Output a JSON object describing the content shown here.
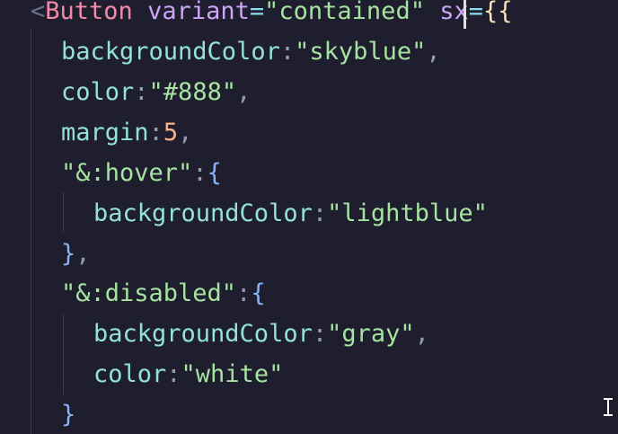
{
  "editor": {
    "theme_colors": {
      "background": "#1e1e2e",
      "tag": "#f38ba8",
      "attribute": "#cba6f7",
      "string": "#a6e3a1",
      "property": "#94e2d5",
      "number": "#fab387",
      "brace": "#f9e2af"
    },
    "lines": [
      {
        "tokens": [
          {
            "text": "<",
            "kind": "tag-punct"
          },
          {
            "text": "Button",
            "kind": "tag"
          },
          {
            "text": " ",
            "kind": "punct"
          },
          {
            "text": "variant",
            "kind": "attr"
          },
          {
            "text": "=",
            "kind": "op"
          },
          {
            "text": "\"contained\"",
            "kind": "str"
          },
          {
            "text": " ",
            "kind": "punct"
          },
          {
            "text": "sx",
            "kind": "attr"
          },
          {
            "text": "=",
            "kind": "op"
          },
          {
            "text": "{{",
            "kind": "brace"
          }
        ]
      },
      {
        "tokens": [
          {
            "text": "backgroundColor",
            "kind": "prop"
          },
          {
            "text": ":",
            "kind": "punct"
          },
          {
            "text": "\"skyblue\"",
            "kind": "str"
          },
          {
            "text": ",",
            "kind": "punct"
          }
        ]
      },
      {
        "tokens": [
          {
            "text": "color",
            "kind": "prop"
          },
          {
            "text": ":",
            "kind": "punct"
          },
          {
            "text": "\"#888\"",
            "kind": "str"
          },
          {
            "text": ",",
            "kind": "punct"
          }
        ]
      },
      {
        "tokens": [
          {
            "text": "margin",
            "kind": "prop"
          },
          {
            "text": ":",
            "kind": "punct"
          },
          {
            "text": "5",
            "kind": "num"
          },
          {
            "text": ",",
            "kind": "punct"
          }
        ]
      },
      {
        "tokens": [
          {
            "text": "\"&:hover\"",
            "kind": "str"
          },
          {
            "text": ":",
            "kind": "punct"
          },
          {
            "text": "{",
            "kind": "paren"
          }
        ]
      },
      {
        "tokens": [
          {
            "text": "backgroundColor",
            "kind": "prop"
          },
          {
            "text": ":",
            "kind": "punct"
          },
          {
            "text": "\"lightblue\"",
            "kind": "str"
          }
        ]
      },
      {
        "tokens": [
          {
            "text": "}",
            "kind": "paren"
          },
          {
            "text": ",",
            "kind": "punct"
          }
        ]
      },
      {
        "tokens": [
          {
            "text": "\"&:disabled\"",
            "kind": "str"
          },
          {
            "text": ":",
            "kind": "punct"
          },
          {
            "text": "{",
            "kind": "paren"
          }
        ]
      },
      {
        "tokens": [
          {
            "text": "backgroundColor",
            "kind": "prop"
          },
          {
            "text": ":",
            "kind": "punct"
          },
          {
            "text": "\"gray\"",
            "kind": "str"
          },
          {
            "text": ",",
            "kind": "punct"
          }
        ]
      },
      {
        "tokens": [
          {
            "text": "color",
            "kind": "prop"
          },
          {
            "text": ":",
            "kind": "punct"
          },
          {
            "text": "\"white\"",
            "kind": "str"
          }
        ]
      },
      {
        "tokens": [
          {
            "text": "}",
            "kind": "paren"
          }
        ]
      }
    ]
  }
}
